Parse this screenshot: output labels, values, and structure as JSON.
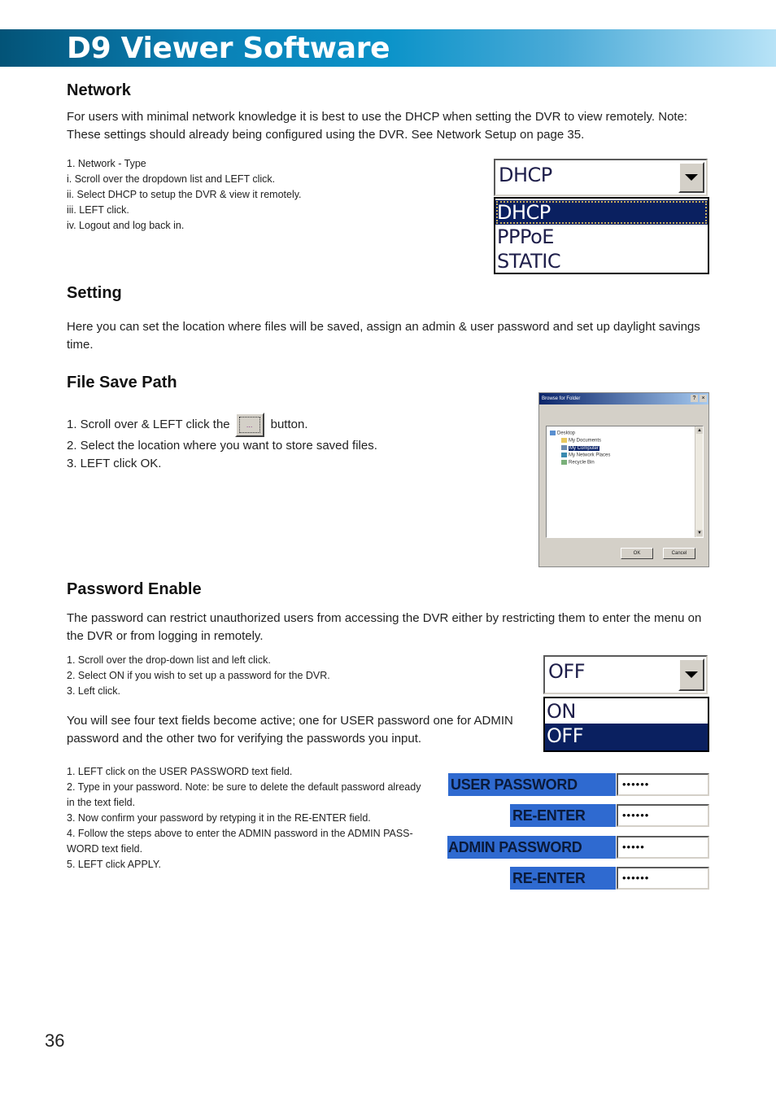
{
  "header": {
    "title": "D9 Viewer Software"
  },
  "network": {
    "heading": "Network",
    "intro": [
      "For users with minimal network knowledge it is best to use the DHCP when setting the DVR to view remotely. Note:",
      "These settings should already being configured using the DVR. See Network Setup on page 35."
    ],
    "steps": [
      "1. Network - Type",
      "i. Scroll over the dropdown list and LEFT click.",
      "ii. Select DHCP to setup the DVR & view it remotely.",
      "iii. LEFT click.",
      "iv. Logout and log back in."
    ],
    "dropdown": {
      "selected": "DHCP",
      "options": [
        "DHCP",
        "PPPoE",
        "STATIC"
      ],
      "highlighted": "DHCP"
    }
  },
  "setting": {
    "heading": "Setting",
    "text": [
      "Here you can set the location where files will be saved, assign an admin & user password and set up daylight savings",
      "time."
    ]
  },
  "file_save_path": {
    "heading": "File Save Path",
    "step1_before": "1. Scroll over & LEFT click the",
    "browse_button_label": "...",
    "step1_after": "button.",
    "step2": "2. Select the location where you want to store saved files.",
    "step3": "3. LEFT click OK.",
    "dialog": {
      "title": "Browse for Folder",
      "help": "?",
      "close": "×",
      "tree": [
        {
          "label": "Desktop",
          "selected": false
        },
        {
          "label": "My Documents",
          "selected": false
        },
        {
          "label": "My Computer",
          "selected": true
        },
        {
          "label": "My Network Places",
          "selected": false
        },
        {
          "label": "Recycle Bin",
          "selected": false
        }
      ],
      "ok": "OK",
      "cancel": "Cancel"
    }
  },
  "password_enable": {
    "heading": "Password Enable",
    "intro": [
      "The password can restrict unauthorized users from accessing the DVR either by restricting them to enter the menu on",
      "the DVR or from logging in remotely."
    ],
    "steps": [
      "1. Scroll over the drop-down list and left click.",
      "2. Select ON if you wish to set up a password for the DVR.",
      "3. Left click."
    ],
    "note": [
      "You will see four text fields become active; one for USER password one for ADMIN",
      "password and the other two for verifying the passwords you input."
    ],
    "dropdown": {
      "selected": "OFF",
      "options": [
        "ON",
        "OFF"
      ],
      "highlighted": "OFF"
    },
    "steps2": [
      "1. LEFT click on the USER PASSWORD text field.",
      "2. Type in your password. Note: be sure to delete the default password already",
      "in the text field.",
      "3. Now confirm your password by retyping it in the RE-ENTER field.",
      "4. Follow the steps above to enter the ADMIN password in the ADMIN PASS-",
      "WORD text field.",
      "5. LEFT click APPLY."
    ],
    "fields": [
      {
        "label": "USER PASSWORD",
        "value": "••••••"
      },
      {
        "label": "RE-ENTER",
        "value": "••••••"
      },
      {
        "label": "ADMIN PASSWORD",
        "value": "•••••"
      },
      {
        "label": "RE-ENTER",
        "value": "••••••"
      }
    ]
  },
  "footer": {
    "page_number": "36"
  }
}
